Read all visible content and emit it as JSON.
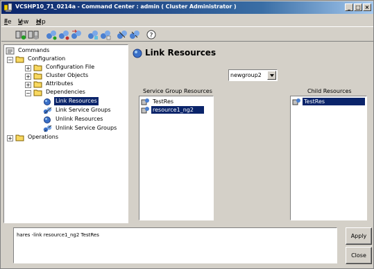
{
  "window": {
    "title": "VCSHP10_71_0214a - Command Center : admin ( Cluster Administrator )",
    "minimize_glyph": "_",
    "maximize_glyph": "□",
    "close_glyph": "×"
  },
  "menu": [
    {
      "first": "F",
      "rest": "ile"
    },
    {
      "first": "V",
      "rest": "iew"
    },
    {
      "first": "H",
      "rest": "elp"
    }
  ],
  "toolbar": {
    "icons": [
      "online-icon",
      "offline-icon",
      "group-online-icon",
      "group-offline-icon",
      "switch-icon",
      "freeze-icon",
      "unfreeze-icon",
      "link-icon",
      "unlink-icon",
      "help-icon"
    ],
    "help_glyph": "?"
  },
  "tree": {
    "root": "Commands",
    "configuration": "Configuration",
    "configuration_file": "Configuration File",
    "cluster_objects": "Cluster Objects",
    "attributes": "Attributes",
    "dependencies": "Dependencies",
    "link_resources": "Link Resources",
    "link_service_groups": "Link Service Groups",
    "unlink_resources": "Unlink Resources",
    "unlink_service_groups": "Unlink Service Groups",
    "operations": "Operations",
    "plus": "+",
    "minus": "−"
  },
  "main": {
    "title": "Link Resources",
    "group_select_value": "newgroup2",
    "service_group_caption": "Service Group Resources",
    "child_caption": "Child Resources",
    "service_group_resources": [
      "TestRes",
      "resource1_ng2"
    ],
    "child_resources": [
      "TestRes"
    ]
  },
  "command": {
    "text": "hares -link resource1_ng2 TestRes"
  },
  "buttons": {
    "apply": "Apply",
    "close": "Close"
  },
  "colors": {
    "titlebar_start": "#0a246a",
    "selection": "#0a246a",
    "face": "#d4d0c8"
  }
}
